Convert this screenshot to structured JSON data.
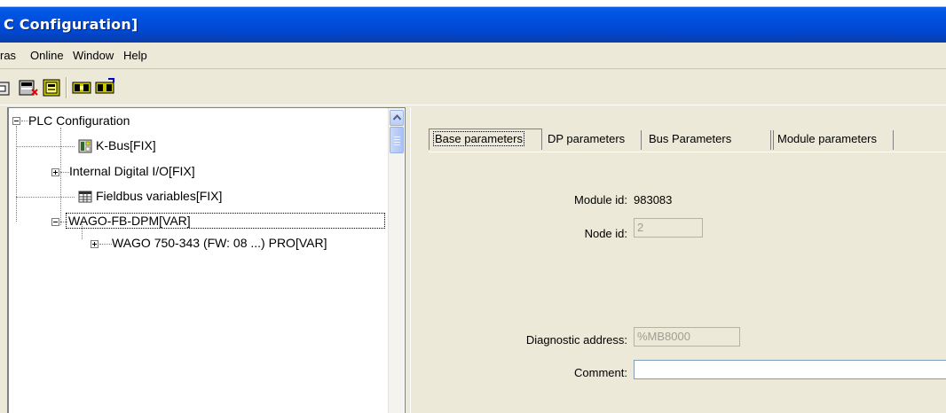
{
  "window": {
    "title": "C Configuration]"
  },
  "menubar": {
    "items": [
      "ras",
      "Online",
      "Window",
      "Help"
    ]
  },
  "toolbar": {
    "buttons": [
      "open-icon",
      "delete-module-icon",
      "properties-icon",
      "compile-icon",
      "download-icon"
    ]
  },
  "tree": {
    "root_label": "PLC Configuration",
    "nodes": [
      {
        "label": "K-Bus[FIX]",
        "icon": "module-icon"
      },
      {
        "label": "Internal Digital I/O[FIX]",
        "icon": ""
      },
      {
        "label": "Fieldbus variables[FIX]",
        "icon": "table-icon"
      },
      {
        "label": "WAGO-FB-DPM[VAR]",
        "icon": ""
      },
      {
        "label": "WAGO 750-343 (FW: 08 ...) PRO[VAR]",
        "icon": ""
      }
    ]
  },
  "tabs": [
    "Base parameters",
    "DP parameters",
    "Bus Parameters",
    "Module parameters"
  ],
  "form": {
    "module_id_label": "Module id:",
    "module_id_value": "983083",
    "node_id_label": "Node id:",
    "node_id_value": "2",
    "diag_label": "Diagnostic address:",
    "diag_value": "%MB8000",
    "comment_label": "Comment:",
    "comment_value": ""
  }
}
